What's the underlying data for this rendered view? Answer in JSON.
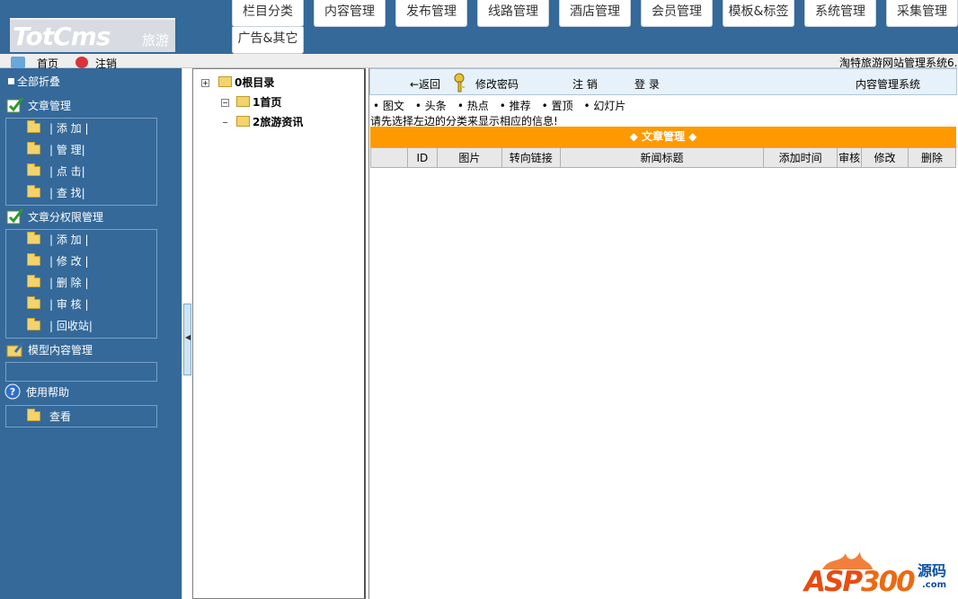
{
  "logo": {
    "text": "TotCms",
    "sub": "旅游"
  },
  "top_tabs": [
    "栏目分类",
    "内容管理",
    "发布管理",
    "线路管理",
    "酒店管理",
    "会员管理",
    "模板&标签",
    "系统管理",
    "采集管理",
    "广告&其它"
  ],
  "subbar": {
    "home": "首页",
    "logout": "注销",
    "site_title": "淘特旅游网站管理系统6."
  },
  "sidebar": {
    "collapse_all": "全部折叠",
    "sections": [
      {
        "title": "文章管理",
        "items": [
          "| 添 加 |",
          "| 管 理|",
          "| 点 击|",
          "| 查 找|"
        ]
      },
      {
        "title": "文章分权限管理",
        "items": [
          "| 添 加 |",
          "| 修 改 |",
          "| 删 除 |",
          "| 审 核 |",
          "| 回收站|"
        ]
      },
      {
        "title": "模型内容管理",
        "items": []
      },
      {
        "title": "使用帮助",
        "items": [
          "查看"
        ]
      }
    ]
  },
  "tree": {
    "root": "0根目录",
    "nodes": [
      "1首页",
      "2旅游资讯"
    ]
  },
  "toolbar": {
    "back": "←返回",
    "change_password": "修改密码",
    "logout": "注 销",
    "login": "登 录",
    "system": "内容管理系统"
  },
  "filters": [
    "• 图文",
    "• 头条",
    "• 热点",
    "• 推荐",
    "• 置顶",
    "• 幻灯片"
  ],
  "hint": "请先选择左边的分类来显示相应的信息!",
  "panel_title": "◆ 文章管理 ◆",
  "table": {
    "columns": [
      "",
      "ID",
      "图片",
      "转向链接",
      "新闻标题",
      "添加时间",
      "审核",
      "修改",
      "删除"
    ]
  },
  "watermark": {
    "main_a": "ASP",
    "main_b": "300",
    "cn": "源码",
    "com": ".com"
  },
  "colors": {
    "nav_blue": "#34699a",
    "panel_orange": "#ff9900",
    "toolbar_bg": "#e6f1fa"
  }
}
